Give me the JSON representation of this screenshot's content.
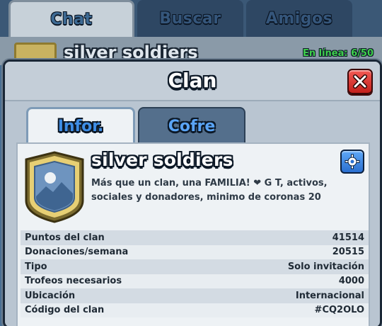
{
  "top_tabs": [
    {
      "label": "Chat"
    },
    {
      "label": "Buscar"
    },
    {
      "label": "Amigos"
    }
  ],
  "background": {
    "clan_name": "silver soldiers",
    "online_text": "En línea: 6/50"
  },
  "modal": {
    "title": "Clan",
    "tabs": [
      {
        "label": "Infor.",
        "active": true
      },
      {
        "label": "Cofre",
        "active": false
      }
    ]
  },
  "clan": {
    "name": "silver soldiers",
    "description": "Más que un clan, una FAMILIA! ❤ G T, activos, sociales y donadores, minimo de coronas 20",
    "badge_icon": "mountain-shield-icon",
    "badge_color": "#d8b85a"
  },
  "stats": [
    {
      "label": "Puntos del clan",
      "value": "41514"
    },
    {
      "label": "Donaciones/semana",
      "value": "20515"
    },
    {
      "label": "Tipo",
      "value": "Solo invitación"
    },
    {
      "label": "Trofeos necesarios",
      "value": "4000"
    },
    {
      "label": "Ubicación",
      "value": "Internacional"
    },
    {
      "label": "Código del clan",
      "value": "#CQ2OLO"
    }
  ],
  "colors": {
    "accent_blue": "#3f8ee6",
    "close_red": "#d6302a",
    "online_green": "#3fcf4d"
  }
}
